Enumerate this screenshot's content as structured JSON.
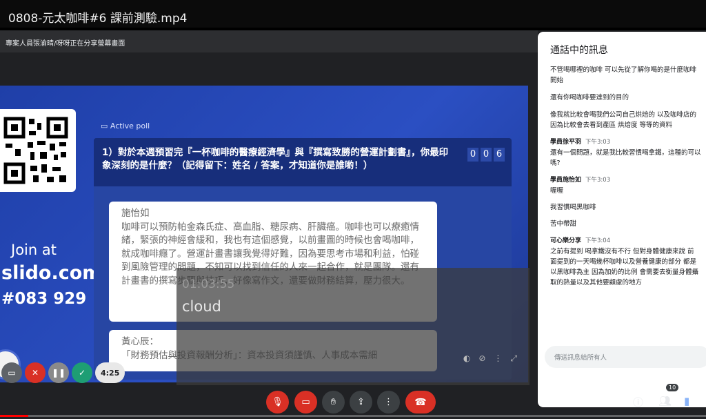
{
  "video": {
    "title": "0808-元太咖啡#6 課前測驗.mp4",
    "progress": 0.04
  },
  "meet": {
    "presenting_text": "專案人員張渝晴/呀呀正在分享螢幕畫面",
    "slide": {
      "join_label": "Join at",
      "site": "slido.com",
      "event_code": "#083 929",
      "poll_label": "Active poll",
      "question": "1）對於本週預習完『一杯咖啡的醫療經濟學』與『撰寫致勝的營運計劃書』，你最印象深刻的是什麼？（記得留下：姓名 / 答案，才知道你是誰喲！）",
      "counter": [
        "0",
        "0",
        "6"
      ],
      "answers": [
        {
          "name": "施怡如",
          "text": "咖啡可以預防帕金森氏症、高血脂、糖尿病、肝臟癌。咖啡也可以療癒情緒，緊張的神經會緩和，我也有這個感覺，以前畫圖的時候也會喝咖啡，就成咖啡癮了。營運計畫書讓我覺得好難，因為要思考市場和利益，怕碰到風險管理的問題，不知可以找到信任的人來一起合作，就是團隊。還有計畫書的撰寫步驟與技巧，好像寫作文，還要做財務結算，壓力很大。"
        },
        {
          "name": "黃心辰：",
          "text": "「財務預估與投資報酬分析」：資本投資須謹慎、人事成本需細"
        }
      ]
    },
    "overlay": {
      "time": "01:03:55",
      "text": "cloud"
    },
    "chat": {
      "title": "通話中的訊息",
      "input_placeholder": "傳送訊息給所有人",
      "messages": [
        {
          "lines": [
            "不管喝哪裡的咖啡 可以先從了解你喝的是什麼咖啡",
            "開始"
          ]
        },
        {
          "lines": [
            "還有你喝咖啡要達到的目的"
          ]
        },
        {
          "lines": [
            "像我就比較會喝我們公司自己烘焙的 以及咖啡店的",
            "因為比較會去看到產區 烘焙度 等等的資料"
          ]
        },
        {
          "sender": "學員徐平羽",
          "time": "下午3:03",
          "lines": [
            "還有一個問題，就是我比較習慣喝拿鐵，這種的可以",
            "嗎?"
          ]
        },
        {
          "sender": "學員施怡如",
          "time": "下午3:03",
          "lines": [
            "喔喔",
            "我習慣喝黑咖啡",
            "苦中帶甜"
          ]
        },
        {
          "sender": "可心樂分享",
          "time": "下午3:04",
          "lines": [
            "之前有提到 喝拿鐵沒有不行 但對身體健康來說 前",
            "面提到的一天喝幾杯咖啡以及營養健康的部分 都是",
            "以黑咖啡為主 因為加奶的比例 會需要去衡量身體攝",
            "取的熱量以及其他要顧慮的地方"
          ]
        }
      ]
    },
    "participant_badge": "10"
  },
  "recorder": {
    "time": "4:25"
  },
  "colors": {
    "slide_blue": "#2b4fc2",
    "danger_red": "#d93025",
    "chat_bg": "#ffffff"
  },
  "icons": [
    "qr-code",
    "poll-icon",
    "mic-off-icon",
    "camera-off-icon",
    "hand-icon",
    "present-icon",
    "more-icon",
    "hang-up-icon",
    "info-icon",
    "people-icon",
    "chat-icon"
  ]
}
